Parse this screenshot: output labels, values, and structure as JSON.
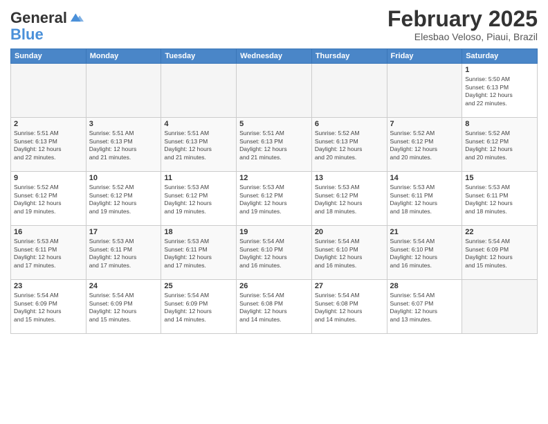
{
  "header": {
    "logo_line1": "General",
    "logo_line2": "Blue",
    "month_title": "February 2025",
    "location": "Elesbao Veloso, Piaui, Brazil"
  },
  "days_of_week": [
    "Sunday",
    "Monday",
    "Tuesday",
    "Wednesday",
    "Thursday",
    "Friday",
    "Saturday"
  ],
  "weeks": [
    {
      "days": [
        {
          "num": "",
          "info": ""
        },
        {
          "num": "",
          "info": ""
        },
        {
          "num": "",
          "info": ""
        },
        {
          "num": "",
          "info": ""
        },
        {
          "num": "",
          "info": ""
        },
        {
          "num": "",
          "info": ""
        },
        {
          "num": "1",
          "info": "Sunrise: 5:50 AM\nSunset: 6:13 PM\nDaylight: 12 hours\nand 22 minutes."
        }
      ]
    },
    {
      "days": [
        {
          "num": "2",
          "info": "Sunrise: 5:51 AM\nSunset: 6:13 PM\nDaylight: 12 hours\nand 22 minutes."
        },
        {
          "num": "3",
          "info": "Sunrise: 5:51 AM\nSunset: 6:13 PM\nDaylight: 12 hours\nand 21 minutes."
        },
        {
          "num": "4",
          "info": "Sunrise: 5:51 AM\nSunset: 6:13 PM\nDaylight: 12 hours\nand 21 minutes."
        },
        {
          "num": "5",
          "info": "Sunrise: 5:51 AM\nSunset: 6:13 PM\nDaylight: 12 hours\nand 21 minutes."
        },
        {
          "num": "6",
          "info": "Sunrise: 5:52 AM\nSunset: 6:13 PM\nDaylight: 12 hours\nand 20 minutes."
        },
        {
          "num": "7",
          "info": "Sunrise: 5:52 AM\nSunset: 6:12 PM\nDaylight: 12 hours\nand 20 minutes."
        },
        {
          "num": "8",
          "info": "Sunrise: 5:52 AM\nSunset: 6:12 PM\nDaylight: 12 hours\nand 20 minutes."
        }
      ]
    },
    {
      "days": [
        {
          "num": "9",
          "info": "Sunrise: 5:52 AM\nSunset: 6:12 PM\nDaylight: 12 hours\nand 19 minutes."
        },
        {
          "num": "10",
          "info": "Sunrise: 5:52 AM\nSunset: 6:12 PM\nDaylight: 12 hours\nand 19 minutes."
        },
        {
          "num": "11",
          "info": "Sunrise: 5:53 AM\nSunset: 6:12 PM\nDaylight: 12 hours\nand 19 minutes."
        },
        {
          "num": "12",
          "info": "Sunrise: 5:53 AM\nSunset: 6:12 PM\nDaylight: 12 hours\nand 19 minutes."
        },
        {
          "num": "13",
          "info": "Sunrise: 5:53 AM\nSunset: 6:12 PM\nDaylight: 12 hours\nand 18 minutes."
        },
        {
          "num": "14",
          "info": "Sunrise: 5:53 AM\nSunset: 6:11 PM\nDaylight: 12 hours\nand 18 minutes."
        },
        {
          "num": "15",
          "info": "Sunrise: 5:53 AM\nSunset: 6:11 PM\nDaylight: 12 hours\nand 18 minutes."
        }
      ]
    },
    {
      "days": [
        {
          "num": "16",
          "info": "Sunrise: 5:53 AM\nSunset: 6:11 PM\nDaylight: 12 hours\nand 17 minutes."
        },
        {
          "num": "17",
          "info": "Sunrise: 5:53 AM\nSunset: 6:11 PM\nDaylight: 12 hours\nand 17 minutes."
        },
        {
          "num": "18",
          "info": "Sunrise: 5:53 AM\nSunset: 6:11 PM\nDaylight: 12 hours\nand 17 minutes."
        },
        {
          "num": "19",
          "info": "Sunrise: 5:54 AM\nSunset: 6:10 PM\nDaylight: 12 hours\nand 16 minutes."
        },
        {
          "num": "20",
          "info": "Sunrise: 5:54 AM\nSunset: 6:10 PM\nDaylight: 12 hours\nand 16 minutes."
        },
        {
          "num": "21",
          "info": "Sunrise: 5:54 AM\nSunset: 6:10 PM\nDaylight: 12 hours\nand 16 minutes."
        },
        {
          "num": "22",
          "info": "Sunrise: 5:54 AM\nSunset: 6:09 PM\nDaylight: 12 hours\nand 15 minutes."
        }
      ]
    },
    {
      "days": [
        {
          "num": "23",
          "info": "Sunrise: 5:54 AM\nSunset: 6:09 PM\nDaylight: 12 hours\nand 15 minutes."
        },
        {
          "num": "24",
          "info": "Sunrise: 5:54 AM\nSunset: 6:09 PM\nDaylight: 12 hours\nand 15 minutes."
        },
        {
          "num": "25",
          "info": "Sunrise: 5:54 AM\nSunset: 6:09 PM\nDaylight: 12 hours\nand 14 minutes."
        },
        {
          "num": "26",
          "info": "Sunrise: 5:54 AM\nSunset: 6:08 PM\nDaylight: 12 hours\nand 14 minutes."
        },
        {
          "num": "27",
          "info": "Sunrise: 5:54 AM\nSunset: 6:08 PM\nDaylight: 12 hours\nand 14 minutes."
        },
        {
          "num": "28",
          "info": "Sunrise: 5:54 AM\nSunset: 6:07 PM\nDaylight: 12 hours\nand 13 minutes."
        },
        {
          "num": "",
          "info": ""
        }
      ]
    }
  ]
}
